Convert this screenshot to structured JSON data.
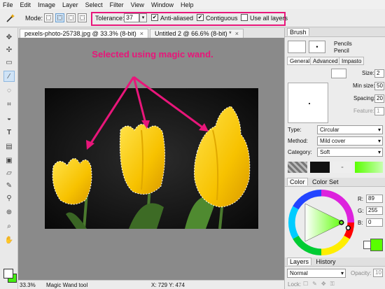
{
  "menu": [
    "File",
    "Edit",
    "Image",
    "Layer",
    "Select",
    "Filter",
    "View",
    "Window",
    "Help"
  ],
  "options": {
    "mode_label": "Mode:",
    "tolerance_label": "Tolerance:",
    "tolerance_value": "37",
    "anti_aliased_label": "Anti-aliased",
    "anti_aliased_checked": true,
    "contiguous_label": "Contiguous",
    "contiguous_checked": true,
    "use_all_layers_label": "Use all layers",
    "use_all_layers_checked": false
  },
  "tabs": [
    {
      "label": "pexels-photo-25738.jpg @ 33.3% (8-bit)",
      "close": "×"
    },
    {
      "label": "Untitled 2 @ 66.6% (8-bit) *",
      "close": "×"
    }
  ],
  "annotation": "Selected using magic wand.",
  "status": {
    "zoom": "33.3%",
    "tool": "Magic Wand tool",
    "coords": "X: 729  Y: 474"
  },
  "brush": {
    "title": "Brush",
    "preset_line1": "Pencils",
    "preset_line2": "Pencil",
    "tabs": [
      "General",
      "Advanced",
      "Impasto"
    ],
    "size_label": "Size:",
    "size_value": "2",
    "min_size_label": "Min size:",
    "min_size_value": "50",
    "spacing_label": "Spacing:",
    "spacing_value": "20",
    "feature_label": "Feature:",
    "feature_value": "1",
    "type_label": "Type:",
    "type_value": "Circular",
    "method_label": "Method:",
    "method_value": "Mild cover",
    "category_label": "Category:",
    "category_value": "Soft"
  },
  "color": {
    "tabs": [
      "Color",
      "Color Set"
    ],
    "r_label": "R:",
    "r_value": "89",
    "g_label": "G:",
    "g_value": "255",
    "b_label": "B:",
    "b_value": "0",
    "current_color": "#59ff00"
  },
  "layers": {
    "tabs": [
      "Layers",
      "History"
    ],
    "blend_mode": "Normal",
    "opacity_label": "Opacity:",
    "opacity_value": "10",
    "lock_label": "Lock:"
  },
  "colors": {
    "accent": "#e8167a",
    "foreground": "#ffffff",
    "background": "#44ee11"
  }
}
